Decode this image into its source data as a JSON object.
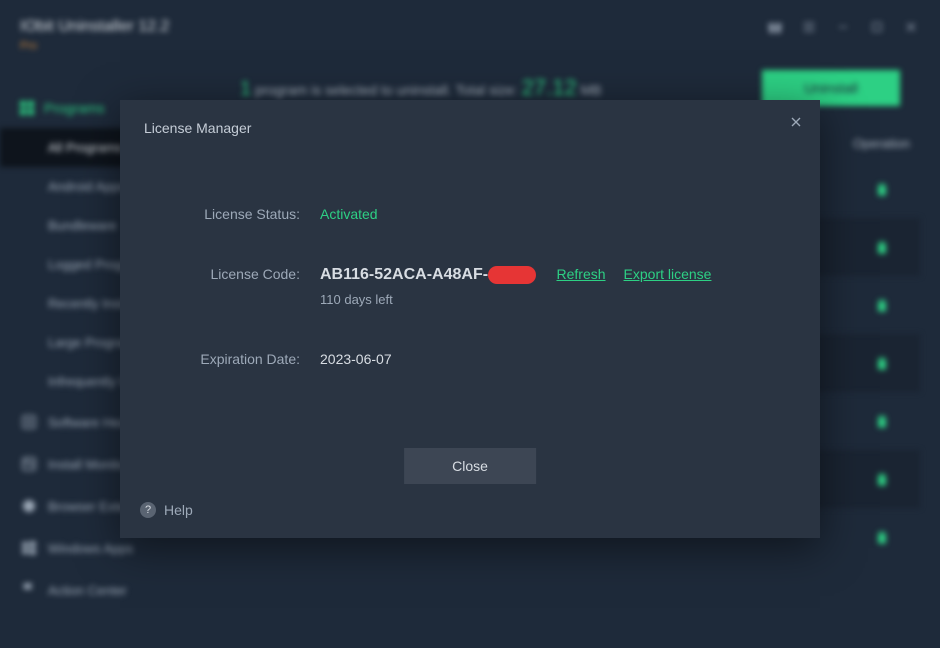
{
  "app": {
    "title": "IObit Uninstaller 12.2",
    "edition": "Pro"
  },
  "windowControls": {
    "gift": "gift-icon",
    "menu": "menu-icon",
    "minimize": "minimize-icon",
    "maximize": "maximize-icon",
    "close": "close-icon"
  },
  "summary": {
    "pre_count": "1",
    "mid": "program is selected to uninstall. Total size:",
    "size": "27.12",
    "unit": "MB"
  },
  "actions": {
    "uninstall": "Uninstall"
  },
  "sidebar": {
    "section": "Programs",
    "items": [
      "All Programs",
      "Android Apps",
      "Bundleware",
      "Logged Programs",
      "Recently Installed",
      "Large Programs",
      "Infrequently Used"
    ],
    "lower": [
      {
        "label": "Software Health"
      },
      {
        "label": "Install Monitor"
      },
      {
        "label": "Browser Extensions"
      },
      {
        "label": "Windows Apps"
      },
      {
        "label": "Action Center"
      }
    ]
  },
  "table": {
    "col_operation": "Operation"
  },
  "modal": {
    "title": "License Manager",
    "fields": {
      "status_label": "License Status:",
      "status_value": "Activated",
      "code_label": "License Code:",
      "code_value": "AB116-52ACA-A48AF-",
      "refresh": "Refresh",
      "export": "Export license",
      "days_left": "110 days left",
      "exp_label": "Expiration Date:",
      "exp_value": "2023-06-07"
    },
    "close": "Close",
    "help": "Help"
  }
}
